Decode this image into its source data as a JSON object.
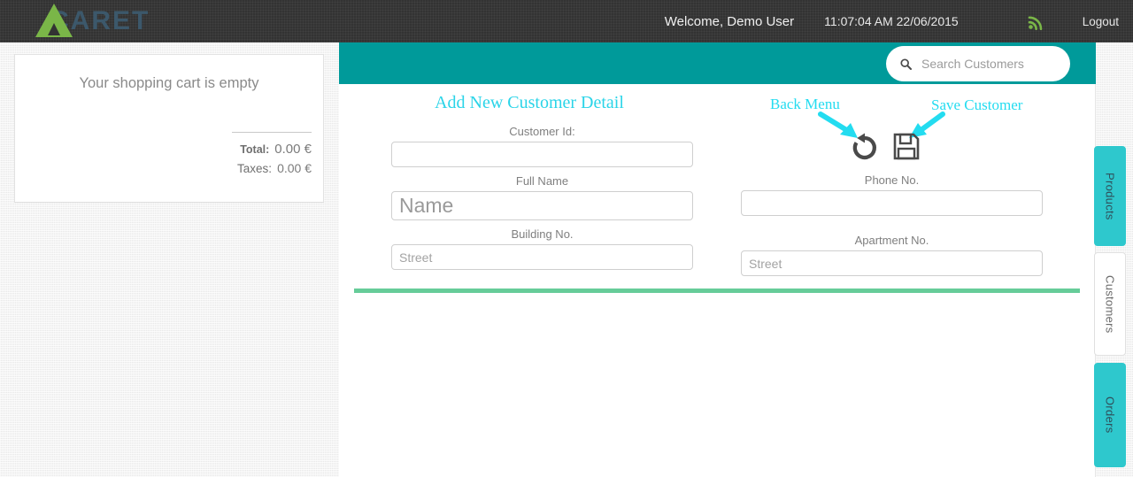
{
  "app": {
    "logo_text": "CARET",
    "brand_green": "#7ab648",
    "brand_teal": "#009a9a",
    "tab_teal": "#2ec8cd",
    "accent_cyan": "#23dcf0",
    "separator_green": "#66cc99"
  },
  "header": {
    "welcome": "Welcome, Demo User",
    "clock": "11:07:04 AM 22/06/2015",
    "feed_icon": "rss-icon",
    "logout_label": "Logout"
  },
  "cart": {
    "empty_message": "Your shopping cart is empty",
    "total_label": "Total:",
    "total_value": "0.00 €",
    "taxes_label": "Taxes:",
    "taxes_value": "0.00 €"
  },
  "search": {
    "icon": "search-icon",
    "placeholder": "Search Customers",
    "value": ""
  },
  "form": {
    "title": "Add New Customer Detail",
    "left_fields": [
      {
        "label": "Customer Id:",
        "placeholder": "",
        "value": ""
      },
      {
        "label": "Full Name",
        "placeholder": "Name",
        "value": ""
      },
      {
        "label": "Building No.",
        "placeholder": "Street",
        "value": ""
      }
    ],
    "right_fields": [
      {
        "label": "Phone No.",
        "placeholder": "",
        "value": ""
      },
      {
        "label": "Apartment No.",
        "placeholder": "Street",
        "value": ""
      }
    ]
  },
  "annotations": [
    {
      "label": "Back Menu",
      "target_icon": "undo-arrow-icon"
    },
    {
      "label": "Save Customer",
      "target_icon": "floppy-disk-icon"
    }
  ],
  "actions": {
    "back_icon": "undo-arrow-icon",
    "save_icon": "floppy-disk-icon"
  },
  "side_tabs": [
    {
      "label": "Products",
      "active": false
    },
    {
      "label": "Customers",
      "active": true
    },
    {
      "label": "Orders",
      "active": false
    }
  ]
}
